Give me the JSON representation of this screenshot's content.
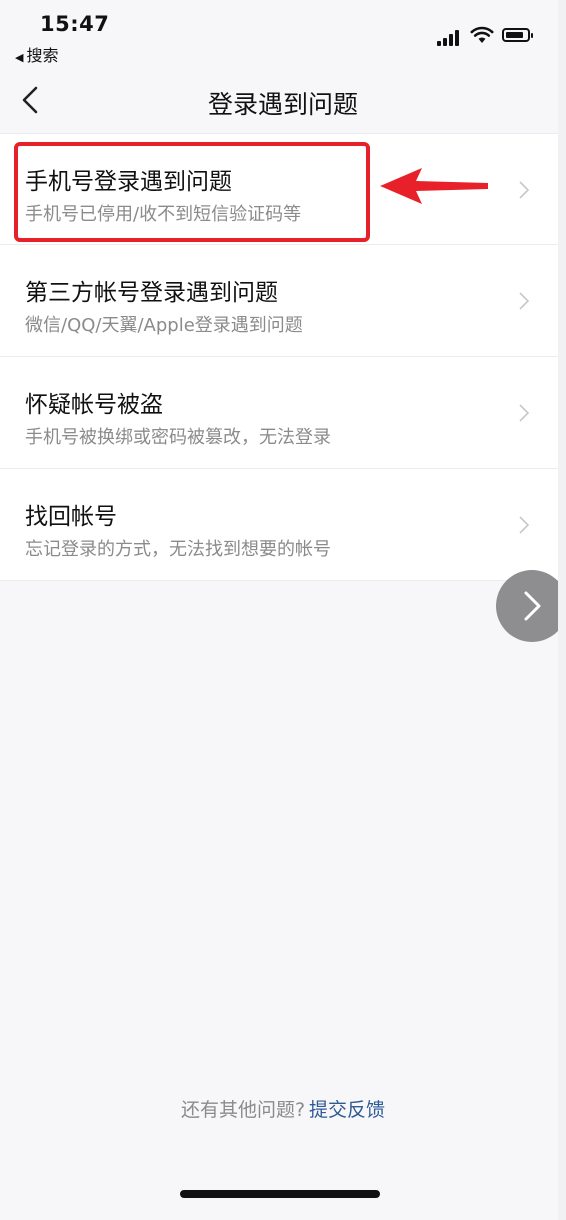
{
  "status_bar": {
    "time": "15:47",
    "back_app_label": "搜索"
  },
  "nav": {
    "title": "登录遇到问题"
  },
  "menu_items": [
    {
      "title": "手机号登录遇到问题",
      "subtitle": "手机号已停用/收不到短信验证码等"
    },
    {
      "title": "第三方帐号登录遇到问题",
      "subtitle": "微信/QQ/天翼/Apple登录遇到问题"
    },
    {
      "title": "怀疑帐号被盗",
      "subtitle": "手机号被换绑或密码被篡改，无法登录"
    },
    {
      "title": "找回帐号",
      "subtitle": "忘记登录的方式，无法找到想要的帐号"
    }
  ],
  "footer": {
    "label": "还有其他问题?",
    "link": "提交反馈"
  },
  "colors": {
    "highlight": "#e8202a",
    "link": "#2e5a96",
    "subtitle": "#8b8b8b"
  },
  "icons": {
    "nav_back": "chevron-left-icon",
    "row_arrow": "chevron-right-icon",
    "floating": "chevron-right-icon"
  }
}
